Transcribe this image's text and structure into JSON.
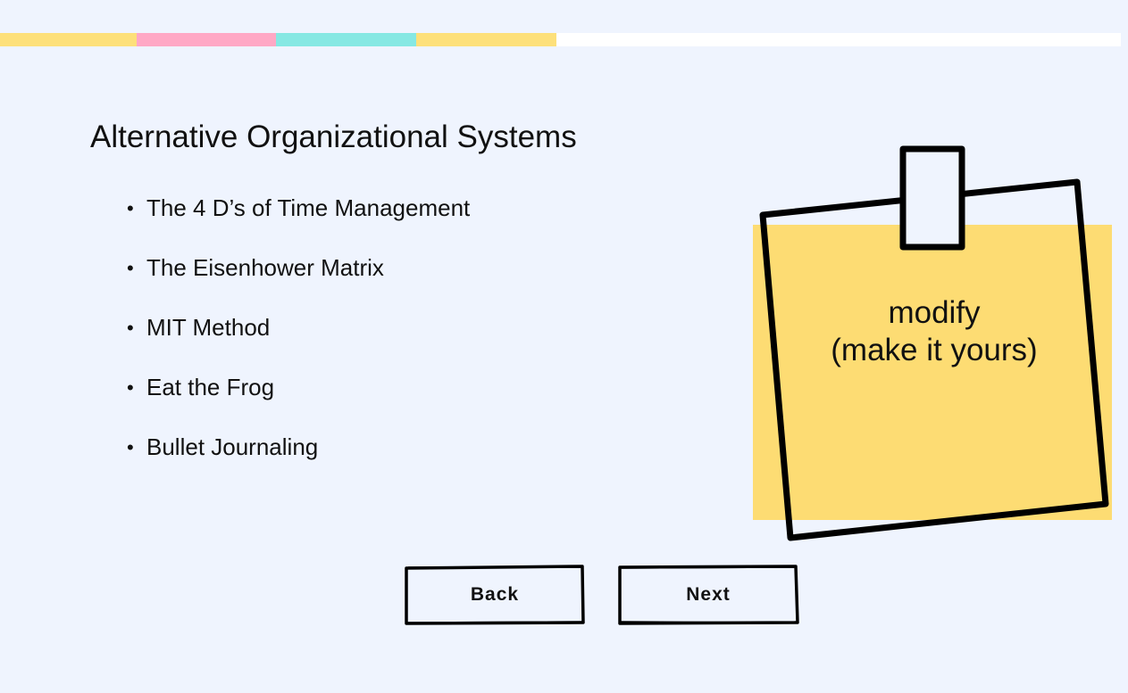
{
  "progress": {
    "segments": [
      {
        "color": "#fde07a"
      },
      {
        "color": "#ffa8c5"
      },
      {
        "color": "#86e8e3"
      },
      {
        "color": "#fde07a"
      }
    ],
    "completed_fraction": 0.496
  },
  "slide": {
    "title": "Alternative Organizational Systems",
    "bullets": [
      "The 4 D’s of Time Management",
      "The Eisenhower Matrix",
      "MIT Method",
      "Eat the Frog",
      "Bullet Journaling"
    ],
    "bullet_symbol": "•"
  },
  "sticky_note": {
    "line1": "modify",
    "line2": "(make it yours)",
    "fill_color": "#fddc73",
    "outline_color": "#000000"
  },
  "navigation": {
    "back_label": "Back",
    "next_label": "Next"
  }
}
